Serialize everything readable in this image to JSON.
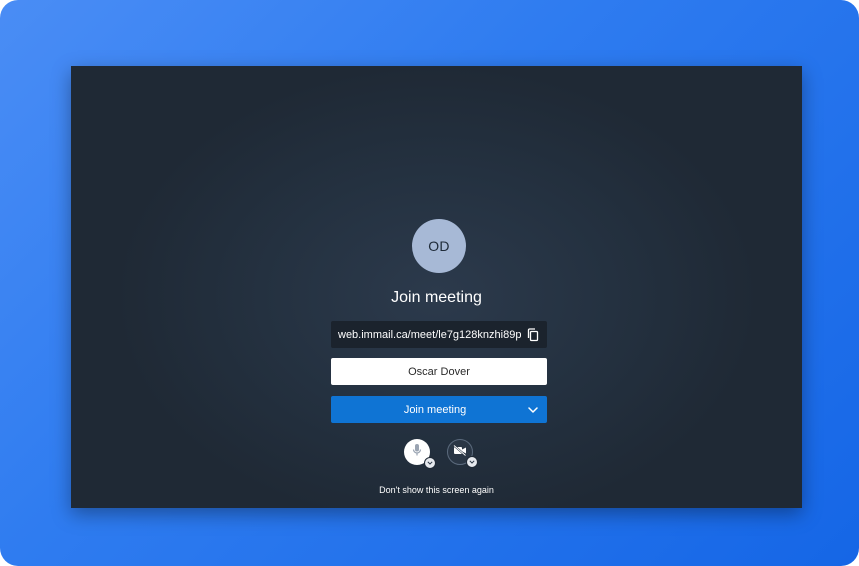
{
  "avatar": {
    "initials": "OD"
  },
  "dialog": {
    "title": "Join meeting",
    "meeting_url": "web.immail.ca/meet/le7g128knzhi89p",
    "name_value": "Oscar Dover",
    "join_button_label": "Join meeting",
    "dont_show_label": "Don't show this screen again"
  },
  "icons": {
    "copy": "copy-icon",
    "dropdown": "chevron-down-icon",
    "mic": "microphone-icon",
    "camera": "camera-off-icon"
  },
  "colors": {
    "frame_gradient_start": "#4a8df5",
    "frame_gradient_end": "#1566e6",
    "window_bg": "#243140",
    "avatar_bg": "#a7b9d6",
    "primary_button": "#0f74d4",
    "url_box_bg": "#1b232d"
  }
}
